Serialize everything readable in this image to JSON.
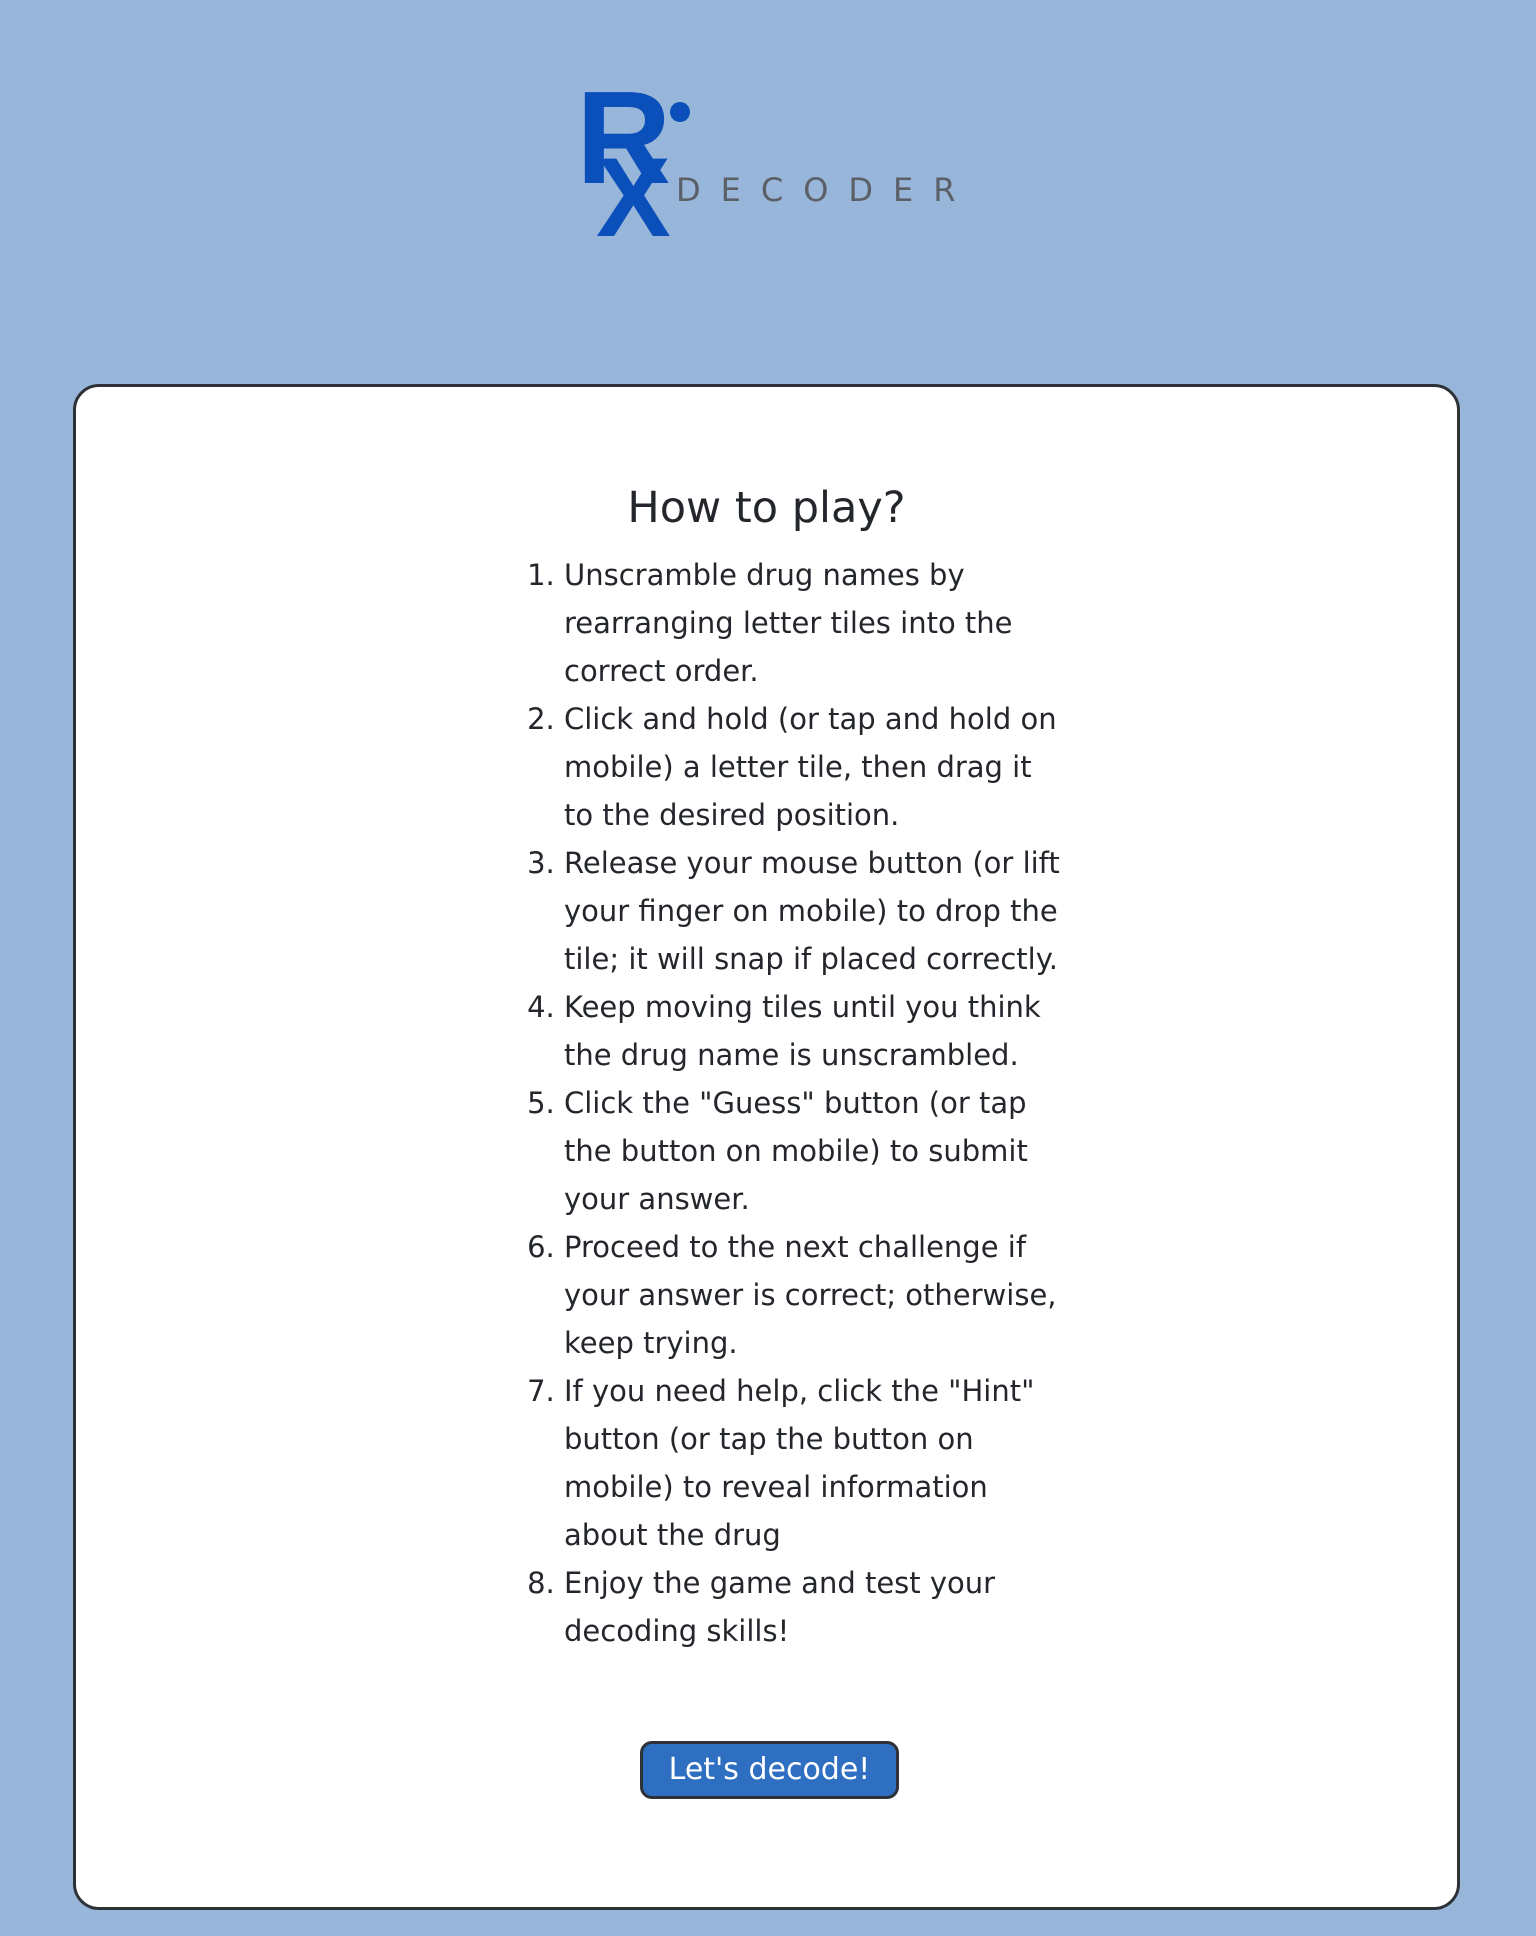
{
  "logo": {
    "mark_letters": "Rx",
    "wordmark": "DECODER"
  },
  "instructions": {
    "title": "How to play?",
    "steps": [
      "Unscramble drug names by rearranging letter tiles into the correct order.",
      "Click and hold (or tap and hold on mobile) a letter tile, then drag it to the desired position.",
      "Release your mouse button (or lift your finger on mobile) to drop the tile; it will snap if placed correctly.",
      "Keep moving tiles until you think the drug name is unscrambled.",
      "Click the \"Guess\" button (or tap the button on mobile) to submit your answer.",
      "Proceed to the next challenge if your answer is correct; otherwise, keep trying.",
      "If you need help, click the \"Hint\" button (or tap the button on mobile) to reveal information about the drug",
      "Enjoy the game and test your decoding skills!"
    ],
    "start_button": "Let's decode!"
  },
  "colors": {
    "page_background": "#98b5da",
    "brand_blue": "#0b4fba",
    "button_blue": "#2e6fc2",
    "card_border": "#2e3136",
    "text": "#23262b"
  }
}
